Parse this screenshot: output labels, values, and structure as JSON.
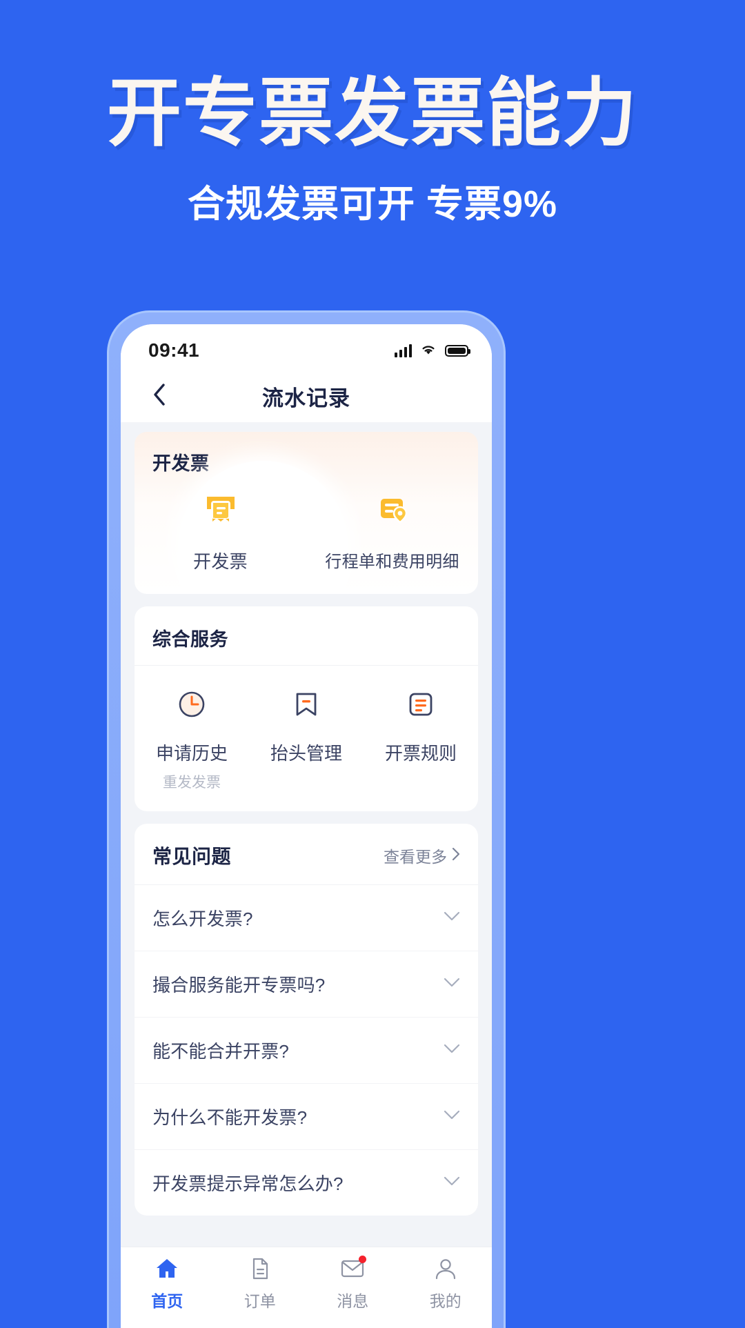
{
  "promo": {
    "title": "开专票发票能力",
    "subtitle": "合规发票可开  专票9%",
    "bg_color": "#2E64F0",
    "title_color": "#FBF6F0"
  },
  "status_bar": {
    "time": "09:41",
    "signal_icon": "signal-bars-icon",
    "wifi_icon": "wifi-icon",
    "battery_icon": "battery-full-icon"
  },
  "nav": {
    "back_icon": "chevron-left-icon",
    "title": "流水记录"
  },
  "invoice_card": {
    "title": "开发票",
    "items": [
      {
        "label": "开发票",
        "icon": "receipt-invoice-icon",
        "highlighted": true
      },
      {
        "label": "行程单和费用明细",
        "icon": "itinerary-location-icon",
        "highlighted": false
      }
    ],
    "accent_color": "#FBBB2E"
  },
  "services_card": {
    "title": "综合服务",
    "items": [
      {
        "label": "申请历史",
        "sub": "重发发票",
        "icon": "clock-history-icon"
      },
      {
        "label": "抬头管理",
        "sub": "",
        "icon": "bookmark-title-icon"
      },
      {
        "label": "开票规则",
        "sub": "",
        "icon": "list-rules-icon"
      }
    ]
  },
  "faq_card": {
    "title": "常见问题",
    "more_label": "查看更多",
    "more_icon": "chevron-right-icon",
    "items": [
      {
        "question": "怎么开发票?",
        "icon": "chevron-down-icon"
      },
      {
        "question": "撮合服务能开专票吗?",
        "icon": "chevron-down-icon"
      },
      {
        "question": "能不能合并开票?",
        "icon": "chevron-down-icon"
      },
      {
        "question": "为什么不能开发票?",
        "icon": "chevron-down-icon"
      },
      {
        "question": "开发票提示异常怎么办?",
        "icon": "chevron-down-icon"
      }
    ]
  },
  "tab_bar": {
    "active_color": "#2E64F0",
    "inactive_color": "#8E93A3",
    "items": [
      {
        "label": "首页",
        "icon": "home-icon",
        "active": true,
        "badge": false
      },
      {
        "label": "订单",
        "icon": "order-document-icon",
        "active": false,
        "badge": false
      },
      {
        "label": "消息",
        "icon": "message-envelope-icon",
        "active": false,
        "badge": true
      },
      {
        "label": "我的",
        "icon": "user-profile-icon",
        "active": false,
        "badge": false
      }
    ]
  }
}
